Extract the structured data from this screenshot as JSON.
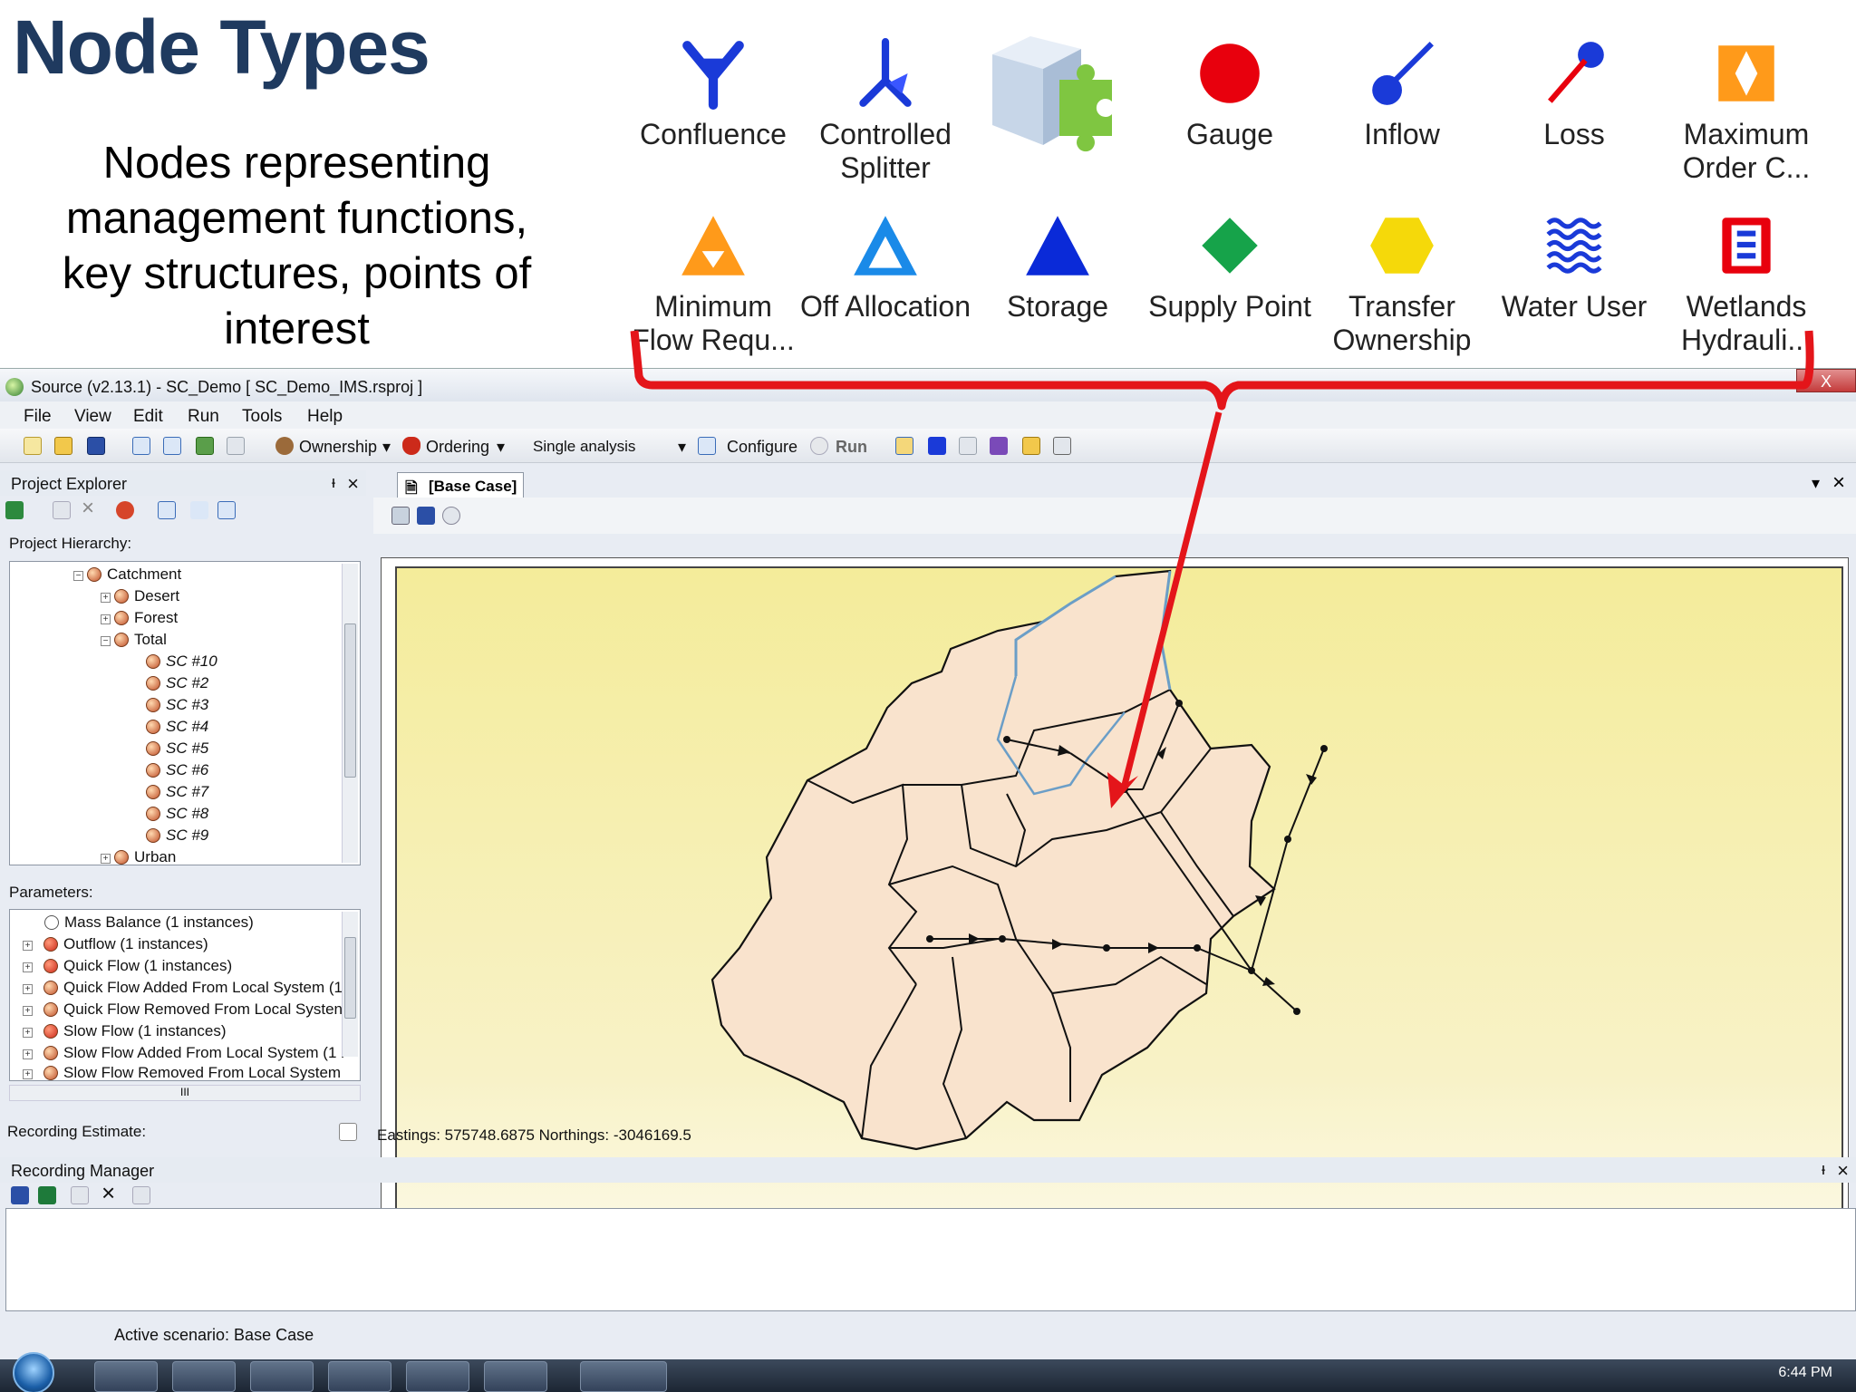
{
  "slide": {
    "title": "Node Types",
    "subtitle": "Nodes representing management functions, key structures, points of interest"
  },
  "node_types": [
    {
      "label": "Confluence",
      "icon": "confluence-icon",
      "color": "#1a3ad8"
    },
    {
      "label": "Controlled\nSplitter",
      "icon": "controlled-splitter-icon",
      "color": "#1a3ad8"
    },
    {
      "label": "",
      "icon": "plugin-icon",
      "color": "#7fc641"
    },
    {
      "label": "Gauge",
      "icon": "gauge-icon",
      "color": "#e8000d"
    },
    {
      "label": "Inflow",
      "icon": "inflow-icon",
      "color": "#1a3ad8"
    },
    {
      "label": "Loss",
      "icon": "loss-icon",
      "color": "#e8000d"
    },
    {
      "label": "Maximum\nOrder C...",
      "icon": "maximum-order-icon",
      "color": "#ff9a1a"
    },
    {
      "label": "Minimum\nFlow Requ...",
      "icon": "minimum-flow-icon",
      "color": "#ff9a1a"
    },
    {
      "label": "Off Allocation",
      "icon": "off-allocation-icon",
      "color": "#1a8ae8"
    },
    {
      "label": "Storage",
      "icon": "storage-icon",
      "color": "#0a2ad8"
    },
    {
      "label": "Supply Point",
      "icon": "supply-point-icon",
      "color": "#16a34a"
    },
    {
      "label": "Transfer\nOwnership",
      "icon": "transfer-ownership-icon",
      "color": "#f5d90a"
    },
    {
      "label": "Water User",
      "icon": "water-user-icon",
      "color": "#1a3ad8"
    },
    {
      "label": "Wetlands\nHydrauli...",
      "icon": "wetlands-icon",
      "color": "#e8000d"
    }
  ],
  "window": {
    "title": "Source (v2.13.1) - SC_Demo [ SC_Demo_IMS.rsproj ]",
    "close_label": "X"
  },
  "menu": [
    "File",
    "View",
    "Edit",
    "Run",
    "Tools",
    "Help"
  ],
  "toolbar": {
    "ownership": "Ownership",
    "ordering": "Ordering",
    "analysis": "Single analysis",
    "configure": "Configure",
    "run": "Run"
  },
  "project_explorer": {
    "title": "Project Explorer",
    "hierarchy_label": "Project Hierarchy:",
    "items": [
      {
        "label": "Catchment",
        "level": 0
      },
      {
        "label": "Desert",
        "level": 1
      },
      {
        "label": "Forest",
        "level": 1
      },
      {
        "label": "Total",
        "level": 1
      },
      {
        "label": "SC #10",
        "level": 2
      },
      {
        "label": "SC #2",
        "level": 2
      },
      {
        "label": "SC #3",
        "level": 2
      },
      {
        "label": "SC #4",
        "level": 2
      },
      {
        "label": "SC #5",
        "level": 2
      },
      {
        "label": "SC #6",
        "level": 2
      },
      {
        "label": "SC #7",
        "level": 2
      },
      {
        "label": "SC #8",
        "level": 2
      },
      {
        "label": "SC #9",
        "level": 2
      },
      {
        "label": "Urban",
        "level": 1
      }
    ]
  },
  "parameters": {
    "label": "Parameters:",
    "items": [
      "Mass Balance (1 instances)",
      "Outflow (1 instances)",
      "Quick Flow (1 instances)",
      "Quick Flow Added From Local System (1",
      "Quick Flow Removed From Local Systen",
      "Slow Flow (1 instances)",
      "Slow Flow Added From Local System (1 i",
      "Slow Flow Removed From Local System"
    ],
    "scroll_label": "III"
  },
  "recording_estimate": "Recording Estimate:",
  "document": {
    "tab": "[Base Case]"
  },
  "map": {
    "coords": "Eastings: 575748.6875 Northings: -3046169.5"
  },
  "recording_manager": {
    "title": "Recording Manager"
  },
  "status": {
    "scenario": "Active scenario: Base Case"
  },
  "taskbar": {
    "time": "6:44 PM"
  }
}
